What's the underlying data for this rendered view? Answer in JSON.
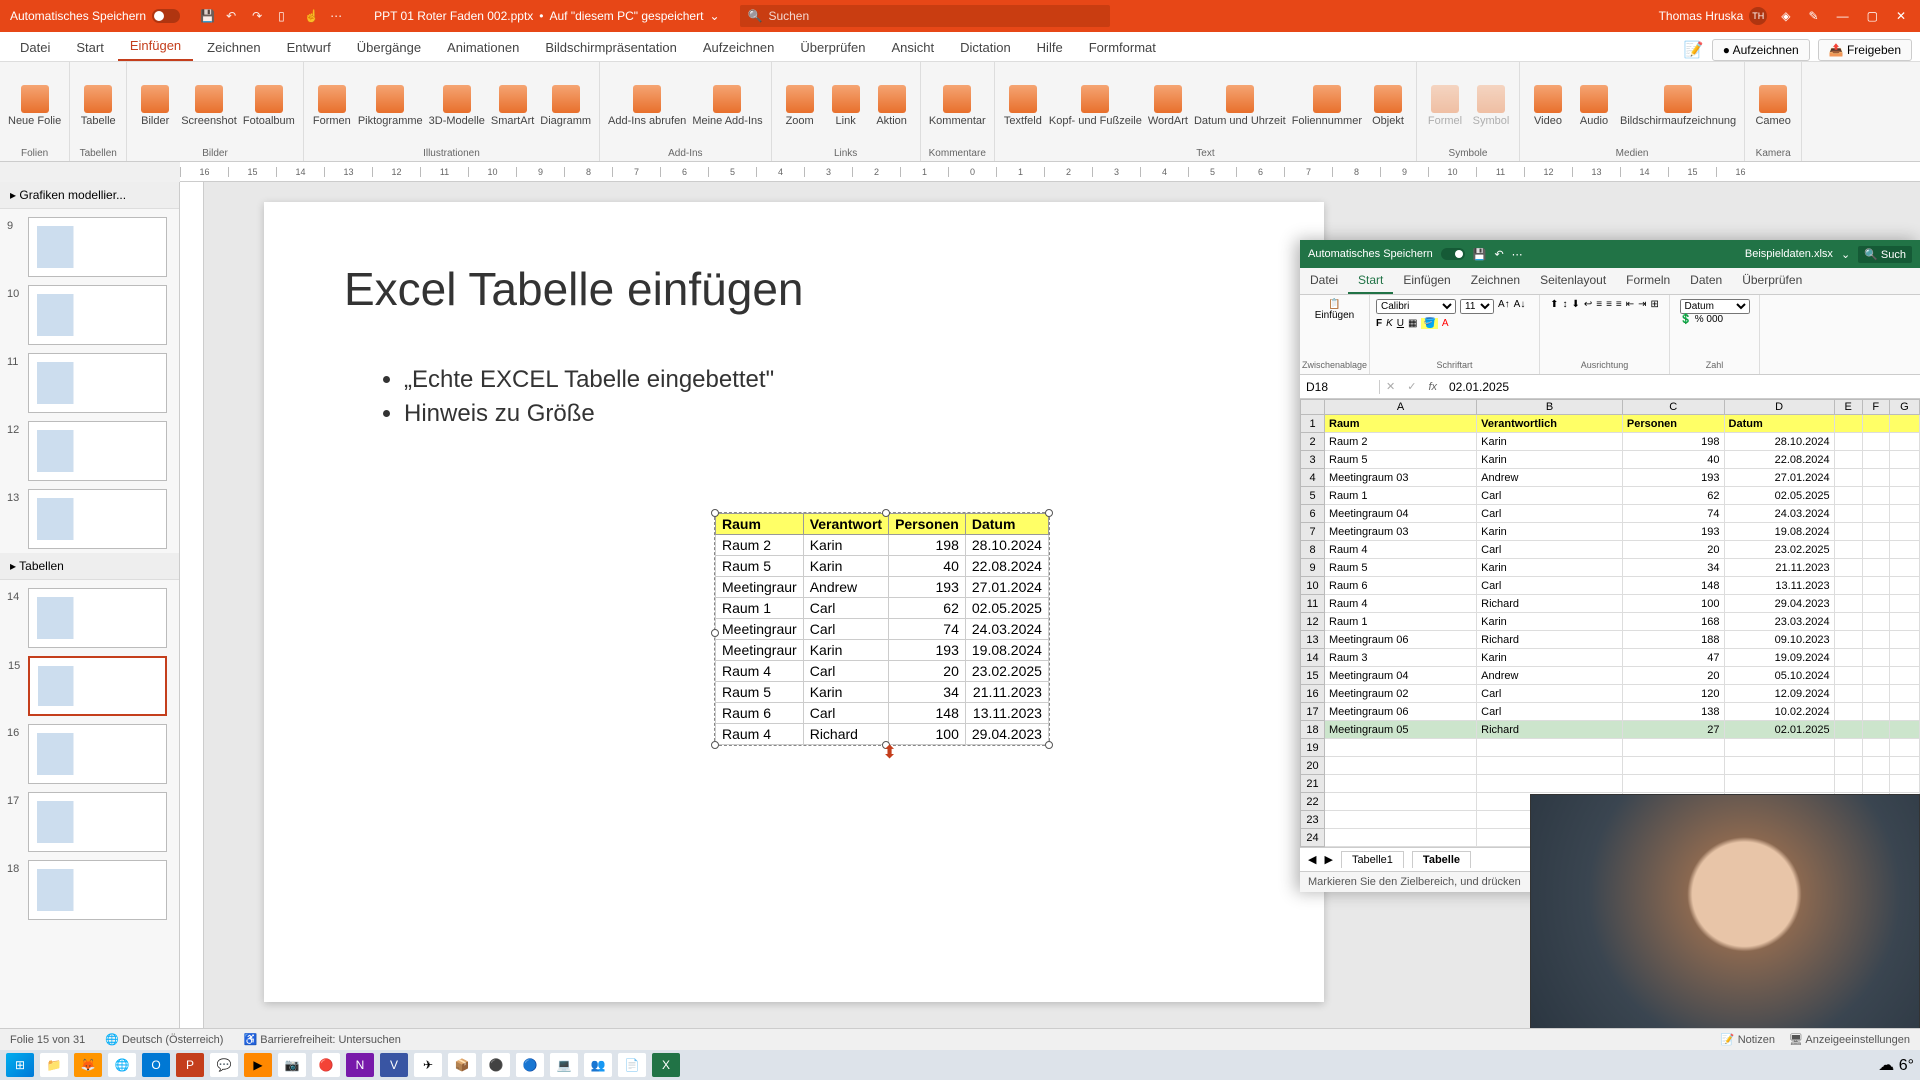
{
  "titlebar": {
    "autosave": "Automatisches Speichern",
    "filename": "PPT 01 Roter Faden 002.pptx",
    "saved_on": "Auf \"diesem PC\" gespeichert",
    "search_placeholder": "Suchen",
    "username": "Thomas Hruska",
    "initials": "TH"
  },
  "tabs": [
    "Datei",
    "Start",
    "Einfügen",
    "Zeichnen",
    "Entwurf",
    "Übergänge",
    "Animationen",
    "Bildschirmpräsentation",
    "Aufzeichnen",
    "Überprüfen",
    "Ansicht",
    "Dictation",
    "Hilfe",
    "Formformat"
  ],
  "active_tab_index": 2,
  "record_btn": "Aufzeichnen",
  "share_btn": "Freigeben",
  "ribbon_groups": [
    {
      "label": "Folien",
      "items": [
        {
          "l": "Neue Folie"
        }
      ]
    },
    {
      "label": "Tabellen",
      "items": [
        {
          "l": "Tabelle"
        }
      ]
    },
    {
      "label": "Bilder",
      "items": [
        {
          "l": "Bilder"
        },
        {
          "l": "Screenshot"
        },
        {
          "l": "Fotoalbum"
        }
      ]
    },
    {
      "label": "Illustrationen",
      "items": [
        {
          "l": "Formen"
        },
        {
          "l": "Piktogramme"
        },
        {
          "l": "3D-Modelle"
        },
        {
          "l": "SmartArt"
        },
        {
          "l": "Diagramm"
        }
      ]
    },
    {
      "label": "Add-Ins",
      "items": [
        {
          "l": "Add-Ins abrufen"
        },
        {
          "l": "Meine Add-Ins"
        }
      ]
    },
    {
      "label": "Links",
      "items": [
        {
          "l": "Zoom"
        },
        {
          "l": "Link"
        },
        {
          "l": "Aktion"
        }
      ]
    },
    {
      "label": "Kommentare",
      "items": [
        {
          "l": "Kommentar"
        }
      ]
    },
    {
      "label": "Text",
      "items": [
        {
          "l": "Textfeld"
        },
        {
          "l": "Kopf- und Fußzeile"
        },
        {
          "l": "WordArt"
        },
        {
          "l": "Datum und Uhrzeit"
        },
        {
          "l": "Foliennummer"
        },
        {
          "l": "Objekt"
        }
      ]
    },
    {
      "label": "Symbole",
      "items": [
        {
          "l": "Formel",
          "d": true
        },
        {
          "l": "Symbol",
          "d": true
        }
      ]
    },
    {
      "label": "Medien",
      "items": [
        {
          "l": "Video"
        },
        {
          "l": "Audio"
        },
        {
          "l": "Bildschirmaufzeichnung"
        }
      ]
    },
    {
      "label": "Kamera",
      "items": [
        {
          "l": "Cameo"
        }
      ]
    }
  ],
  "ruler_marks": [
    "16",
    "15",
    "14",
    "13",
    "12",
    "11",
    "10",
    "9",
    "8",
    "7",
    "6",
    "5",
    "4",
    "3",
    "2",
    "1",
    "0",
    "1",
    "2",
    "3",
    "4",
    "5",
    "6",
    "7",
    "8",
    "9",
    "10",
    "11",
    "12",
    "13",
    "14",
    "15",
    "16"
  ],
  "outline_title": "Grafiken modellier...",
  "section_title": "Tabellen",
  "thumbs": [
    9,
    10,
    11,
    12,
    13,
    14,
    15,
    16,
    17,
    18
  ],
  "selected_thumb": 15,
  "slide": {
    "title": "Excel Tabelle einfügen",
    "bullets": [
      "„Echte EXCEL Tabelle eingebettet\"",
      "Hinweis zu Größe"
    ]
  },
  "chart_data": {
    "type": "table",
    "headers": [
      "Raum",
      "Verantwortlich",
      "Personen",
      "Datum"
    ],
    "headers_short": [
      "Raum",
      "Verantwort",
      "Personen",
      "Datum"
    ],
    "rows_slide": [
      [
        "Raum 2",
        "Karin",
        "198",
        "28.10.2024"
      ],
      [
        "Raum 5",
        "Karin",
        "40",
        "22.08.2024"
      ],
      [
        "Meetingraur",
        "Andrew",
        "193",
        "27.01.2024"
      ],
      [
        "Raum 1",
        "Carl",
        "62",
        "02.05.2025"
      ],
      [
        "Meetingraur",
        "Carl",
        "74",
        "24.03.2024"
      ],
      [
        "Meetingraur",
        "Karin",
        "193",
        "19.08.2024"
      ],
      [
        "Raum 4",
        "Carl",
        "20",
        "23.02.2025"
      ],
      [
        "Raum 5",
        "Karin",
        "34",
        "21.11.2023"
      ],
      [
        "Raum 6",
        "Carl",
        "148",
        "13.11.2023"
      ],
      [
        "Raum 4",
        "Richard",
        "100",
        "29.04.2023"
      ]
    ],
    "rows_excel": [
      [
        "Raum 2",
        "Karin",
        "198",
        "28.10.2024"
      ],
      [
        "Raum 5",
        "Karin",
        "40",
        "22.08.2024"
      ],
      [
        "Meetingraum 03",
        "Andrew",
        "193",
        "27.01.2024"
      ],
      [
        "Raum 1",
        "Carl",
        "62",
        "02.05.2025"
      ],
      [
        "Meetingraum 04",
        "Carl",
        "74",
        "24.03.2024"
      ],
      [
        "Meetingraum 03",
        "Karin",
        "193",
        "19.08.2024"
      ],
      [
        "Raum 4",
        "Carl",
        "20",
        "23.02.2025"
      ],
      [
        "Raum 5",
        "Karin",
        "34",
        "21.11.2023"
      ],
      [
        "Raum 6",
        "Carl",
        "148",
        "13.11.2023"
      ],
      [
        "Raum 4",
        "Richard",
        "100",
        "29.04.2023"
      ],
      [
        "Raum 1",
        "Karin",
        "168",
        "23.03.2024"
      ],
      [
        "Meetingraum 06",
        "Richard",
        "188",
        "09.10.2023"
      ],
      [
        "Raum 3",
        "Karin",
        "47",
        "19.09.2024"
      ],
      [
        "Meetingraum 04",
        "Andrew",
        "20",
        "05.10.2024"
      ],
      [
        "Meetingraum 02",
        "Carl",
        "120",
        "12.09.2024"
      ],
      [
        "Meetingraum 06",
        "Carl",
        "138",
        "10.02.2024"
      ],
      [
        "Meetingraum 05",
        "Richard",
        "27",
        "02.01.2025"
      ]
    ]
  },
  "excel": {
    "autosave": "Automatisches Speichern",
    "filename": "Beispieldaten.xlsx",
    "search": "Such",
    "tabs": [
      "Datei",
      "Start",
      "Einfügen",
      "Zeichnen",
      "Seitenlayout",
      "Formeln",
      "Daten",
      "Überprüfen"
    ],
    "active_tab_index": 1,
    "groups": [
      "Zwischenablage",
      "Schriftart",
      "Ausrichtung",
      "Zahl"
    ],
    "paste": "Einfügen",
    "font": "Calibri",
    "fontsize": "11",
    "number_format": "Datum",
    "cell_name": "D18",
    "formula_value": "02.01.2025",
    "cols": [
      "A",
      "B",
      "C",
      "D",
      "E",
      "F",
      "G"
    ],
    "row_nums": [
      1,
      2,
      3,
      4,
      5,
      6,
      7,
      8,
      9,
      10,
      11,
      12,
      13,
      14,
      15,
      16,
      17,
      18,
      19,
      20,
      21,
      22,
      23,
      24
    ],
    "sheets": [
      "Tabelle1",
      "Tabelle"
    ],
    "active_sheet_index": 1,
    "status": "Markieren Sie den Zielbereich, und drücken"
  },
  "statusbar": {
    "slide_info": "Folie 15 von 31",
    "lang": "Deutsch (Österreich)",
    "access": "Barrierefreiheit: Untersuchen",
    "notes": "Notizen",
    "display": "Anzeigeeinstellungen"
  },
  "taskbar": {
    "temp": "6°"
  }
}
